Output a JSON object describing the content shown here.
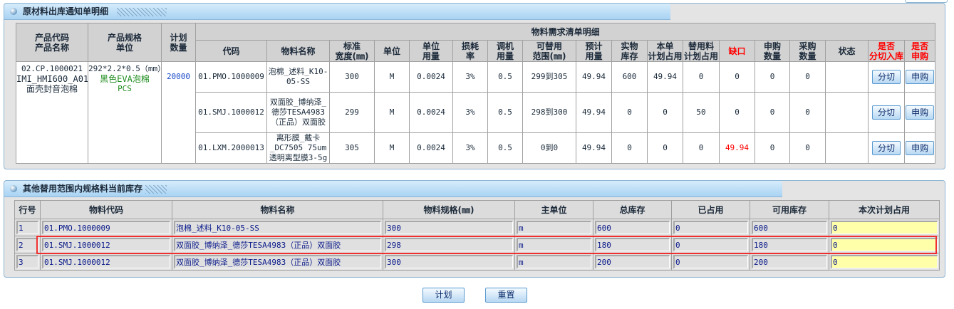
{
  "panel1": {
    "title": "原材料出库通知单明细",
    "headers": {
      "product_code": "产品代码\n产品名称",
      "spec": "产品规格\n单位",
      "plan_qty": "计划\n数量",
      "group": "物料需求清单明细",
      "cols": [
        "代码",
        "物料名称",
        "标准\n宽度(㎜)",
        "单位",
        "单位\n用量",
        "损耗\n率",
        "调机\n用量",
        "可替用\n范围(㎜)",
        "预计\n用量",
        "实物\n库存",
        "本单\n计划占用",
        "替用料\n计划占用",
        "缺口",
        "申购\n数量",
        "采购\n数量",
        "状态",
        "是否\n分切入库",
        "是否\n申购"
      ]
    },
    "product": {
      "code": "02.CP.1000021",
      "name": "IMI_HMI600_A01-面壳封音泡棉",
      "spec": "292*2.2*0.5（mm）",
      "spec_name": "黑色EVA泡棉",
      "unit": "PCS",
      "plan_qty": "20000"
    },
    "rows": [
      {
        "code": "01.PMO.1000009",
        "name": "泡棉_述料_K10-05-SS",
        "width": "300",
        "unit": "M",
        "unit_usage": "0.0024",
        "loss": "3%",
        "adjust": "0.5",
        "range": "299到305",
        "expected": "49.94",
        "stock": "600",
        "plan_occupy": "49.94",
        "alt_occupy": "0",
        "gap": "0",
        "req_qty": "0",
        "pur_qty": "0",
        "status": "",
        "cut": "分切",
        "purchase": "申购"
      },
      {
        "code": "01.SMJ.1000012",
        "name": "双面胶_博纳泽_德莎TESA4983（正品）双面胶",
        "width": "299",
        "unit": "M",
        "unit_usage": "0.0024",
        "loss": "3%",
        "adjust": "0.5",
        "range": "298到300",
        "expected": "49.94",
        "stock": "0",
        "plan_occupy": "0",
        "alt_occupy": "50",
        "gap": "0",
        "req_qty": "0",
        "pur_qty": "0",
        "status": "",
        "cut": "分切",
        "purchase": "申购"
      },
      {
        "code": "01.LXM.2000013",
        "name": "离形膜_戴卡_DC7505 75um透明离型膜3-5g",
        "width": "305",
        "unit": "M",
        "unit_usage": "0.0024",
        "loss": "3%",
        "adjust": "0.5",
        "range": "0到0",
        "expected": "49.94",
        "stock": "0",
        "plan_occupy": "0",
        "alt_occupy": "0",
        "gap": "49.94",
        "req_qty": "0",
        "pur_qty": "0",
        "status": "",
        "cut": "分切",
        "purchase": "申购"
      }
    ]
  },
  "panel2": {
    "title": "其他替用范围内规格料当前库存",
    "headers": [
      "行号",
      "物料代码",
      "物料名称",
      "物料规格(㎜)",
      "主单位",
      "总库存",
      "已占用",
      "可用库存",
      "本次计划占用"
    ],
    "rows": [
      [
        "1",
        "01.PMO.1000009",
        "泡棉_述料_K10-05-SS",
        "300",
        "m",
        "600",
        "0",
        "600",
        "0"
      ],
      [
        "2",
        "01.SMJ.1000012",
        "双面胶_博纳泽_德莎TESA4983（正品）双面胶",
        "298",
        "m",
        "180",
        "0",
        "180",
        "0"
      ],
      [
        "3",
        "01.SMJ.1000012",
        "双面胶_博纳泽_德莎TESA4983（正品）双面胶",
        "300",
        "m",
        "200",
        "0",
        "200",
        "0"
      ]
    ]
  },
  "actions": {
    "plan": "计划",
    "reset": "重置"
  },
  "colors": {
    "accent": "#a9d3f3",
    "gap_red": "#ff0000",
    "highlight": "#f03030",
    "input_yellow": "#ffffaa"
  }
}
